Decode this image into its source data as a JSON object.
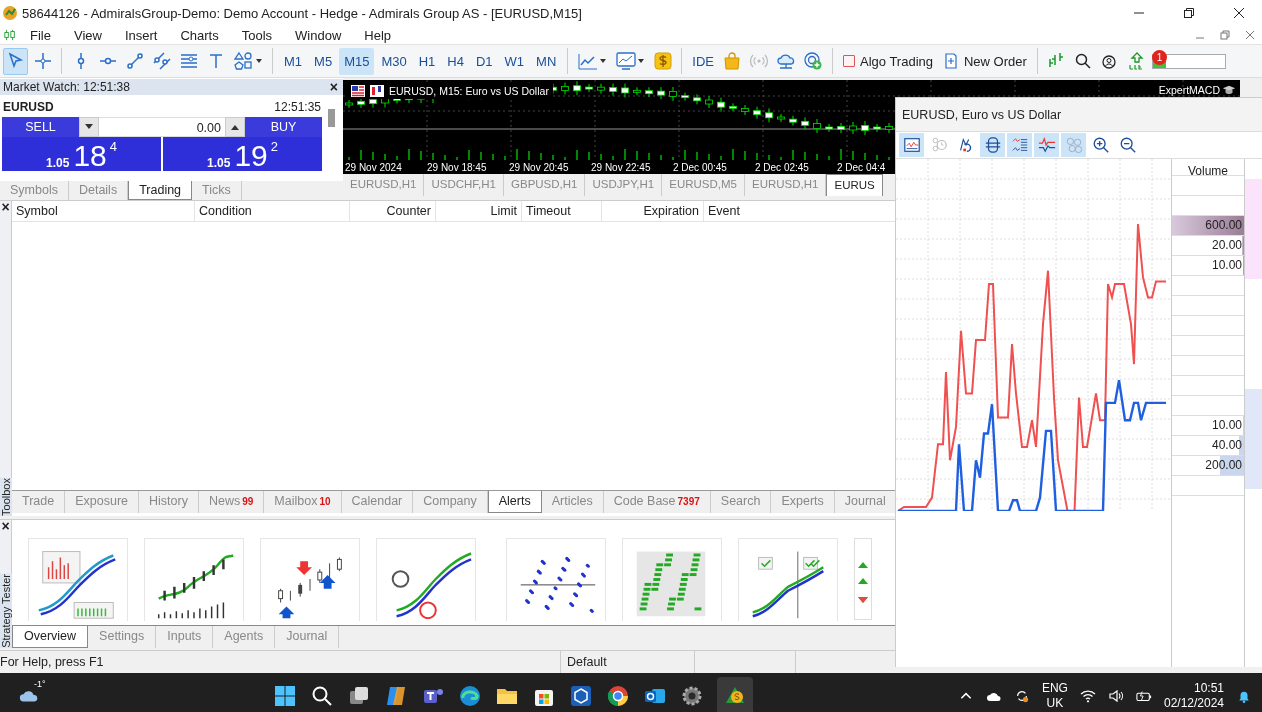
{
  "window": {
    "title": "58644126 - AdmiralsGroup-Demo: Demo Account - Hedge - Admirals Group AS - [EURUSD,M15]"
  },
  "menu": [
    "File",
    "View",
    "Insert",
    "Charts",
    "Tools",
    "Window",
    "Help"
  ],
  "toolbar": {
    "timeframes": [
      {
        "label": "M1",
        "selected": false
      },
      {
        "label": "M5",
        "selected": false
      },
      {
        "label": "M15",
        "selected": true
      },
      {
        "label": "M30",
        "selected": false
      },
      {
        "label": "H1",
        "selected": false
      },
      {
        "label": "H4",
        "selected": false
      },
      {
        "label": "D1",
        "selected": false
      },
      {
        "label": "W1",
        "selected": false
      },
      {
        "label": "MN",
        "selected": false
      }
    ],
    "ide": "IDE",
    "algo_trading": "Algo Trading",
    "new_order": "New Order",
    "notifications": "1",
    "level": 0.18
  },
  "market_watch": {
    "title": "Market Watch: 12:51:38",
    "close": "×",
    "symbol": "EURUSD",
    "time": "12:51:35",
    "sell": "SELL",
    "buy": "BUY",
    "volume": "0.00",
    "bid": {
      "prefix": "1.05",
      "big": "18",
      "pip": "4"
    },
    "ask": {
      "prefix": "1.05",
      "big": "19",
      "pip": "2"
    },
    "tabs": [
      {
        "label": "Symbols",
        "selected": false
      },
      {
        "label": "Details",
        "selected": false
      },
      {
        "label": "Trading",
        "selected": true
      },
      {
        "label": "Ticks",
        "selected": false
      }
    ]
  },
  "chart": {
    "title": "EURUSD, M15:  Euro vs US Dollar",
    "expert": "ExpertMACD",
    "time_labels": [
      "29 Nov 2024",
      "29 Nov 18:45",
      "29 Nov 20:45",
      "29 Nov 22:45",
      "2 Dec 00:45",
      "2 Dec 02:45",
      "2 Dec 04:4"
    ],
    "tabs": [
      {
        "label": "EURUSD,H1",
        "selected": false
      },
      {
        "label": "USDCHF,H1",
        "selected": false
      },
      {
        "label": "GBPUSD,H1",
        "selected": false
      },
      {
        "label": "USDJPY,H1",
        "selected": false
      },
      {
        "label": "EURUSD,M5",
        "selected": false
      },
      {
        "label": "EURUSD,H1",
        "selected": false
      },
      {
        "label": "EURUS",
        "selected": true
      }
    ]
  },
  "toolbox": {
    "side_label": "Toolbox",
    "close": "×",
    "columns": [
      "Symbol",
      "Condition",
      "Counter",
      "Limit",
      "Timeout",
      "Expiration",
      "Event"
    ],
    "tabs": [
      {
        "label": "Trade",
        "selected": false
      },
      {
        "label": "Exposure",
        "selected": false
      },
      {
        "label": "History",
        "selected": false
      },
      {
        "label": "News",
        "badge": "99",
        "selected": false
      },
      {
        "label": "Mailbox",
        "badge": "10",
        "selected": false
      },
      {
        "label": "Calendar",
        "selected": false
      },
      {
        "label": "Company",
        "selected": false
      },
      {
        "label": "Alerts",
        "selected": true
      },
      {
        "label": "Articles",
        "selected": false
      },
      {
        "label": "Code Base",
        "badge": "7397",
        "selected": false
      },
      {
        "label": "Search",
        "selected": false
      },
      {
        "label": "Experts",
        "selected": false
      },
      {
        "label": "Journal",
        "selected": false
      }
    ]
  },
  "strategy_tester": {
    "side_label": "Strategy Tester",
    "close": "×",
    "tabs": [
      {
        "label": "Overview",
        "selected": true
      },
      {
        "label": "Settings",
        "selected": false
      },
      {
        "label": "Inputs",
        "selected": false
      },
      {
        "label": "Agents",
        "selected": false
      },
      {
        "label": "Journal",
        "selected": false
      }
    ]
  },
  "status_bar": {
    "help": "For Help, press F1",
    "profile": "Default"
  },
  "depth_window": {
    "title": "EURUSD, Euro vs US Dollar",
    "tools": [
      {
        "kind": "chart",
        "selected": true
      },
      {
        "kind": "clock",
        "selected": false
      },
      {
        "kind": "magnet",
        "selected": false
      },
      {
        "kind": "center",
        "selected": true
      },
      {
        "kind": "table",
        "selected": true
      },
      {
        "kind": "ticks",
        "selected": true
      },
      {
        "kind": "circles",
        "selected": true
      },
      {
        "kind": "zoom-in",
        "selected": false
      },
      {
        "kind": "zoom-out",
        "selected": false
      }
    ],
    "volume_header": "Volume",
    "sell_rows": [
      {
        "volume": "600.00",
        "level": 1
      },
      {
        "volume": "20.00",
        "level": 0.03
      },
      {
        "volume": "10.00",
        "level": 0.02
      }
    ],
    "buy_rows": [
      {
        "volume": "10.00",
        "level": 0.02
      },
      {
        "volume": "40.00",
        "level": 0.07
      },
      {
        "volume": "200.00",
        "level": 0.33
      }
    ]
  },
  "taskbar": {
    "weather": "-1°",
    "language": "ENG",
    "region": "UK",
    "time": "10:51",
    "date": "02/12/2024"
  }
}
